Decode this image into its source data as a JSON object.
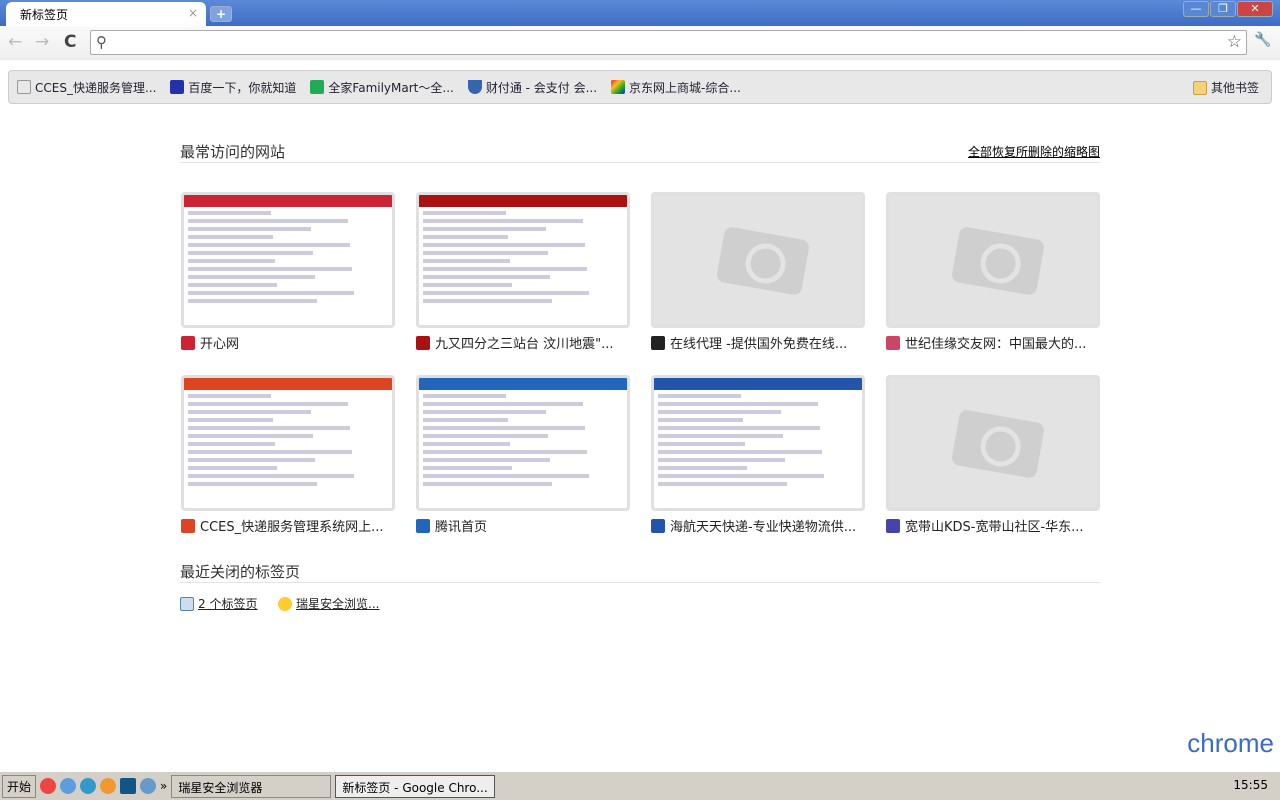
{
  "tab": {
    "title": "新标签页",
    "close": "×",
    "new": "+"
  },
  "window": {
    "min": "—",
    "max": "❐",
    "close": "✕"
  },
  "toolbar": {
    "back": "←",
    "forward": "→",
    "reload": "C",
    "search_icon": "⚲",
    "star": "☆",
    "wrench": "🔧"
  },
  "bookmarks": [
    {
      "label": "CCES_快递服务管理...",
      "color": "#ffffff"
    },
    {
      "label": "百度一下，你就知道",
      "color": "#2233aa"
    },
    {
      "label": "全家FamilyMart～全...",
      "color": "#22aa55"
    },
    {
      "label": "财付通 - 会支付 会...",
      "color": "#3366aa"
    },
    {
      "label": "京东网上商城-综合...",
      "color": "#ee9922"
    }
  ],
  "other_bookmarks": "其他书签",
  "most_visited": {
    "title": "最常访问的网站",
    "restore": "全部恢复所删除的缩略图",
    "tiles": [
      {
        "label": "开心网",
        "thumb": "shot",
        "color": "#cc2233"
      },
      {
        "label": "九又四分之三站台 汶川地震\"...",
        "thumb": "shot",
        "color": "#aa1111"
      },
      {
        "label": "在线代理 -提供国外免费在线...",
        "thumb": "placeholder",
        "color": "#222222"
      },
      {
        "label": "世纪佳缘交友网：中国最大的...",
        "thumb": "placeholder",
        "color": "#cc4466"
      },
      {
        "label": "CCES_快递服务管理系统网上...",
        "thumb": "shot",
        "color": "#dd4422"
      },
      {
        "label": "腾讯首页",
        "thumb": "shot",
        "color": "#2266bb"
      },
      {
        "label": "海航天天快递-专业快递物流供...",
        "thumb": "shot",
        "color": "#2255aa"
      },
      {
        "label": "宽带山KDS-宽带山社区-华东...",
        "thumb": "placeholder",
        "color": "#4444aa"
      }
    ]
  },
  "recently_closed": {
    "title": "最近关闭的标签页",
    "items": [
      {
        "label": "2 个标签页"
      },
      {
        "label": "瑞星安全浏览..."
      }
    ]
  },
  "taskbar": {
    "start": "开始",
    "more": "»",
    "tasks": [
      "瑞星安全浏览器",
      "新标签页 - Google Chro..."
    ],
    "clock": "15:55"
  },
  "brand": "chrome"
}
